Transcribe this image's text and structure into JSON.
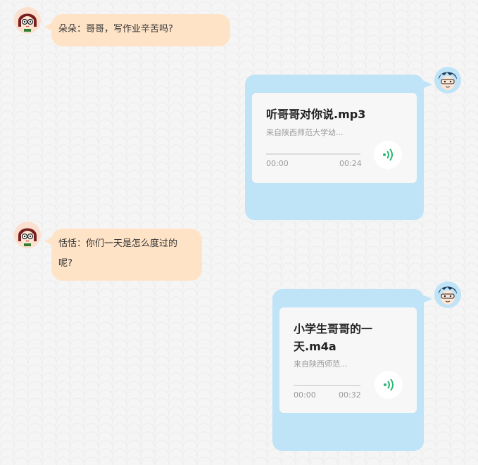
{
  "messages": [
    {
      "type": "text",
      "side": "left",
      "text": "朵朵：哥哥，写作业辛苦吗?"
    },
    {
      "type": "audio",
      "side": "right",
      "title": "听哥哥对你说.mp3",
      "source": "来自陕西师范大学幼...",
      "current_time": "00:00",
      "duration": "00:24",
      "progress": 0
    },
    {
      "type": "text",
      "side": "left",
      "line1": "恬恬：你们一天是怎么度过的",
      "line2": "呢?"
    },
    {
      "type": "audio",
      "side": "right",
      "title_line1": "小学生哥哥的一",
      "title_line2": "天.m4a",
      "source": "来自陕西师范...",
      "current_time": "00:00",
      "duration": "00:32",
      "progress": 0
    }
  ],
  "icons": {
    "girl_avatar": "girl-avatar-icon",
    "boy_avatar": "boy-avatar-icon",
    "audio": "speaker-wave-icon"
  },
  "colors": {
    "left_bubble": "#ffe3c7",
    "right_bubble": "#bfe3f7",
    "audio_icon": "#2bb673"
  }
}
